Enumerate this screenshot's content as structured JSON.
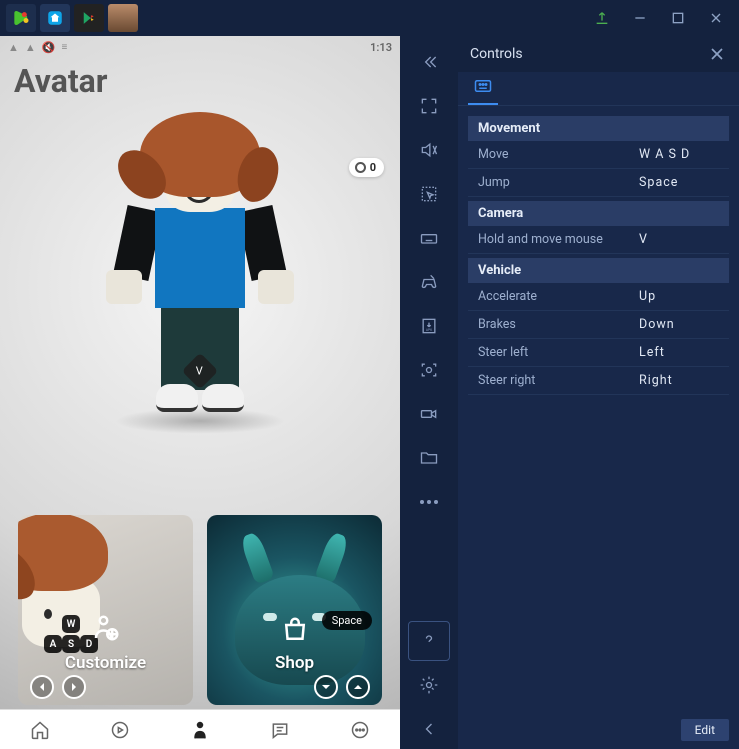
{
  "status": {
    "time": "1:13"
  },
  "currency": {
    "amount": "0"
  },
  "avatar_title": "Avatar",
  "badge_v": "V",
  "cards": {
    "customize": {
      "label": "Customize",
      "keys": {
        "w": "W",
        "a": "A",
        "d": "D",
        "s": "S"
      }
    },
    "shop": {
      "label": "Shop",
      "pill": "Space"
    }
  },
  "controls": {
    "title": "Controls",
    "sections": [
      {
        "head": "Movement",
        "rows": [
          {
            "action": "Move",
            "key": "W A S D"
          },
          {
            "action": "Jump",
            "key": "Space"
          }
        ]
      },
      {
        "head": "Camera",
        "rows": [
          {
            "action": "Hold and move mouse",
            "key": "V"
          }
        ]
      },
      {
        "head": "Vehicle",
        "rows": [
          {
            "action": "Accelerate",
            "key": "Up"
          },
          {
            "action": "Brakes",
            "key": "Down"
          },
          {
            "action": "Steer left",
            "key": "Left"
          },
          {
            "action": "Steer right",
            "key": "Right"
          }
        ]
      }
    ],
    "edit": "Edit"
  }
}
